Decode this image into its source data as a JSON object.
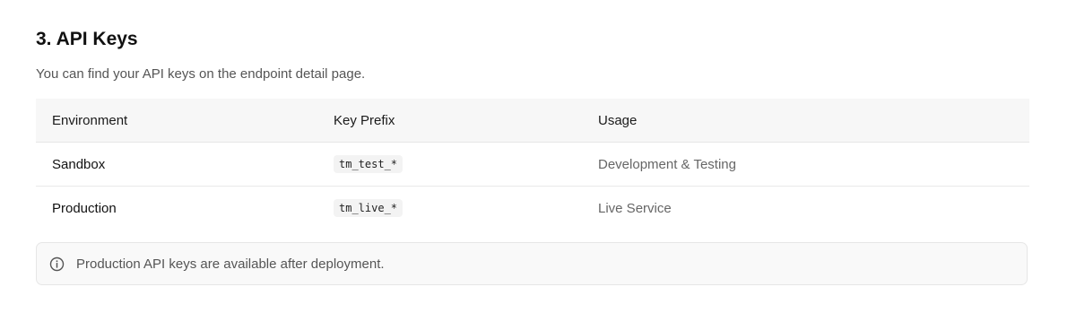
{
  "section": {
    "title": "3. API Keys",
    "description": "You can find your API keys on the endpoint detail page."
  },
  "table": {
    "headers": [
      "Environment",
      "Key Prefix",
      "Usage"
    ],
    "rows": [
      {
        "environment": "Sandbox",
        "key_prefix": "tm_test_*",
        "usage": "Development & Testing"
      },
      {
        "environment": "Production",
        "key_prefix": "tm_live_*",
        "usage": "Live Service"
      }
    ]
  },
  "notice": {
    "icon": "info-icon",
    "text": "Production API keys are available after deployment."
  },
  "colors": {
    "header_bg": "#f7f7f7",
    "notice_bg": "#f9f9f9",
    "muted_text": "#666666"
  }
}
